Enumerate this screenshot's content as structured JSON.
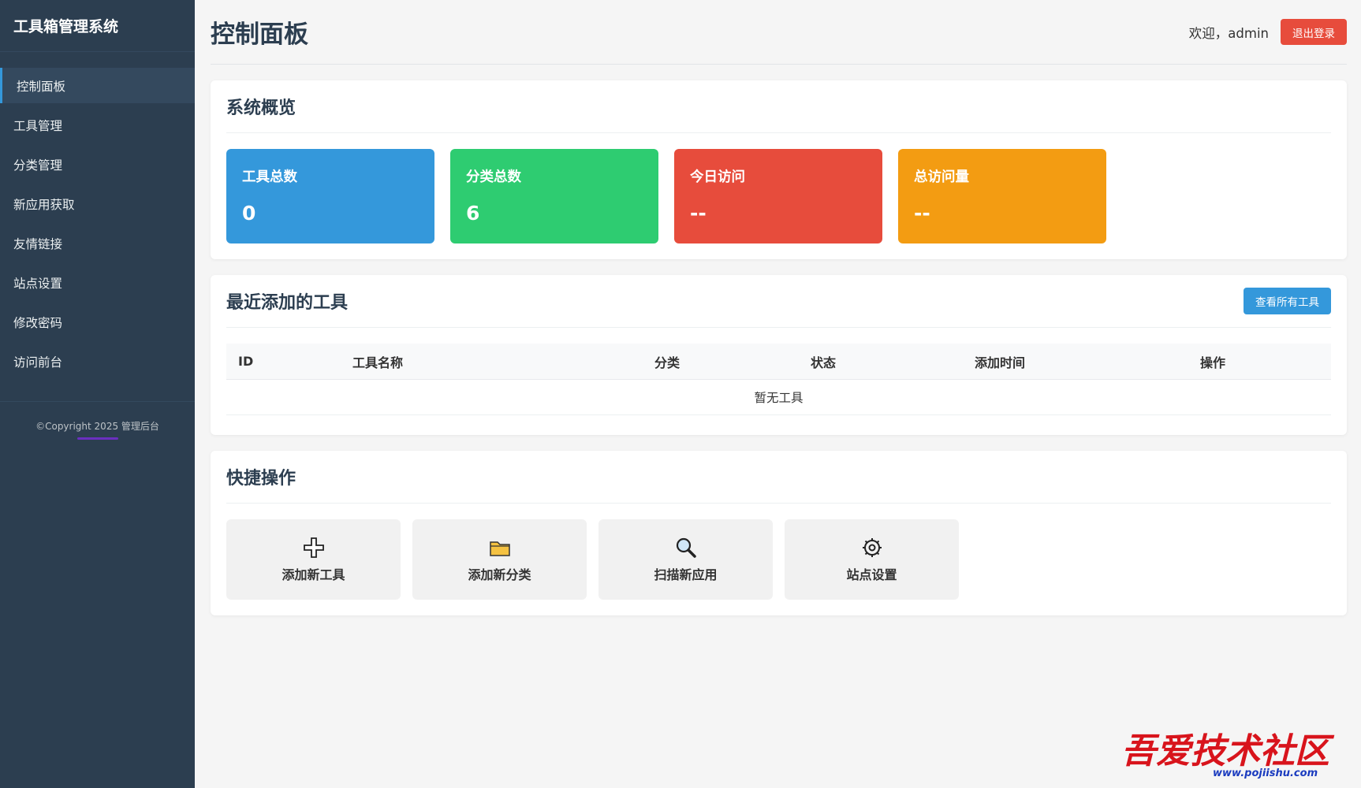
{
  "app": {
    "title": "工具箱管理系统"
  },
  "sidebar": {
    "items": [
      {
        "label": "控制面板"
      },
      {
        "label": "工具管理"
      },
      {
        "label": "分类管理"
      },
      {
        "label": "新应用获取"
      },
      {
        "label": "友情链接"
      },
      {
        "label": "站点设置"
      },
      {
        "label": "修改密码"
      },
      {
        "label": "访问前台"
      }
    ],
    "copyright": "©Copyright 2025 管理后台"
  },
  "header": {
    "title": "控制面板",
    "welcome": "欢迎，admin",
    "logout_label": "退出登录"
  },
  "overview": {
    "title": "系统概览",
    "stats": [
      {
        "label": "工具总数",
        "value": "0",
        "color": "#3498db"
      },
      {
        "label": "分类总数",
        "value": "6",
        "color": "#2ecc71"
      },
      {
        "label": "今日访问",
        "value": "--",
        "color": "#e74c3c"
      },
      {
        "label": "总访问量",
        "value": "--",
        "color": "#f39c12"
      }
    ]
  },
  "recent": {
    "title": "最近添加的工具",
    "view_all_label": "查看所有工具",
    "columns": [
      "ID",
      "工具名称",
      "分类",
      "状态",
      "添加时间",
      "操作"
    ],
    "empty_text": "暂无工具"
  },
  "quick": {
    "title": "快捷操作",
    "actions": [
      {
        "label": "添加新工具",
        "icon": "plus-icon"
      },
      {
        "label": "添加新分类",
        "icon": "folder-icon"
      },
      {
        "label": "扫描新应用",
        "icon": "magnifier-icon"
      },
      {
        "label": "站点设置",
        "icon": "gear-icon"
      }
    ]
  },
  "watermark": {
    "text": "吾爱技术社区",
    "url": "www.pojiishu.com"
  }
}
